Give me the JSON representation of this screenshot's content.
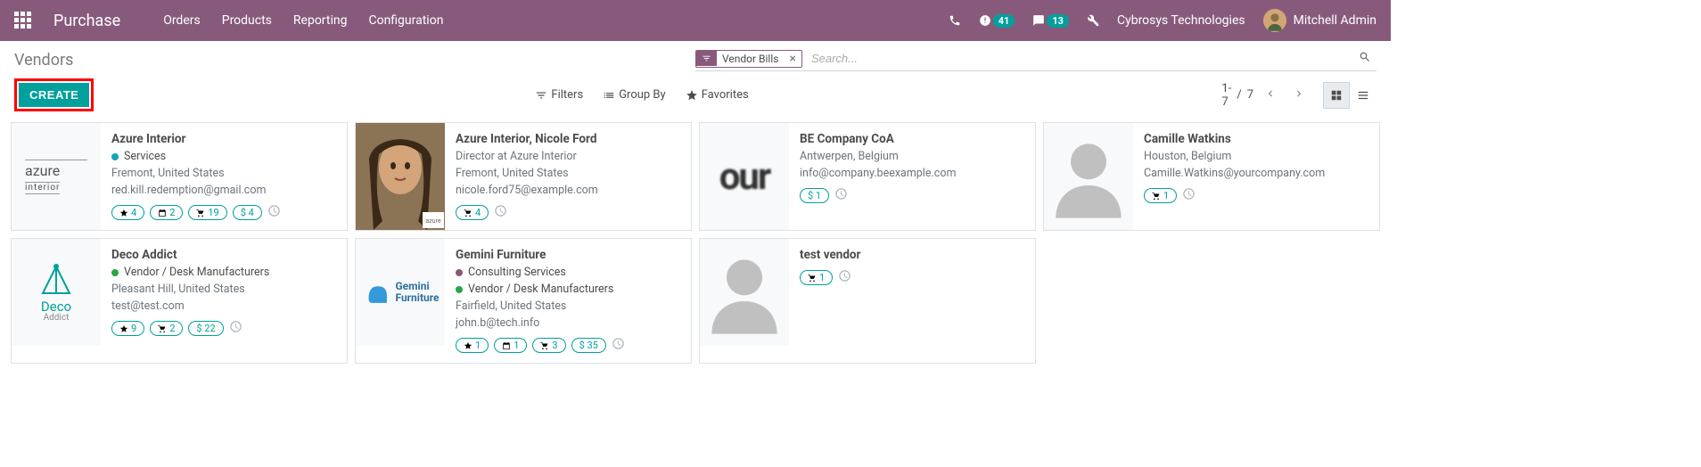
{
  "navbar": {
    "brand": "Purchase",
    "menu": [
      "Orders",
      "Products",
      "Reporting",
      "Configuration"
    ],
    "activity_badge": "41",
    "chat_badge": "13",
    "company": "Cybrosys Technologies",
    "user": "Mitchell Admin"
  },
  "breadcrumb": "Vendors",
  "search": {
    "facet_label": "Vendor Bills",
    "placeholder": "Search..."
  },
  "search_options": {
    "filters": "Filters",
    "group_by": "Group By",
    "favorites": "Favorites"
  },
  "create_label": "CREATE",
  "pager": {
    "range": "1-7",
    "separator": "/",
    "total": "7"
  },
  "cards": [
    {
      "title": "Azure Interior",
      "tags": [
        {
          "color": "blue",
          "label": "Services"
        }
      ],
      "line1": "Fremont, United States",
      "line2": "red.kill.redemption@gmail.com",
      "badges": [
        {
          "icon": "star",
          "value": "4"
        },
        {
          "icon": "calendar",
          "value": "2"
        },
        {
          "icon": "cart",
          "value": "19"
        },
        {
          "icon": "dollar",
          "value": "4"
        }
      ],
      "activity": true,
      "img": "azure-logo"
    },
    {
      "title": "Azure Interior, Nicole Ford",
      "subtitle": "Director at Azure Interior",
      "line1": "Fremont, United States",
      "line2": "nicole.ford75@example.com",
      "badges": [
        {
          "icon": "cart",
          "value": "4"
        }
      ],
      "activity": true,
      "img": "photo-woman"
    },
    {
      "title": "BE Company CoA",
      "line1": "Antwerpen, Belgium",
      "line2": "info@company.beexample.com",
      "badges": [
        {
          "icon": "dollar",
          "value": "1"
        }
      ],
      "activity": true,
      "img": "our-text"
    },
    {
      "title": "Camille Watkins",
      "line1": "Houston, Belgium",
      "line2": "Camille.Watkins@yourcompany.com",
      "badges": [
        {
          "icon": "cart",
          "value": "1"
        }
      ],
      "activity": true,
      "img": "silhouette"
    },
    {
      "title": "Deco Addict",
      "tags": [
        {
          "color": "green",
          "label": "Vendor / Desk Manufacturers"
        }
      ],
      "line1": "Pleasant Hill, United States",
      "line2": "test@test.com",
      "badges": [
        {
          "icon": "star",
          "value": "9"
        },
        {
          "icon": "cart",
          "value": "2"
        },
        {
          "icon": "dollar",
          "value": "22"
        }
      ],
      "activity": true,
      "img": "deco-logo"
    },
    {
      "title": "Gemini Furniture",
      "tags": [
        {
          "color": "purple",
          "label": "Consulting Services"
        },
        {
          "color": "green",
          "label": "Vendor / Desk Manufacturers"
        }
      ],
      "line1": "Fairfield, United States",
      "line2": "john.b@tech.info",
      "badges": [
        {
          "icon": "star",
          "value": "1"
        },
        {
          "icon": "calendar",
          "value": "1"
        },
        {
          "icon": "cart",
          "value": "3"
        },
        {
          "icon": "dollar",
          "value": "35"
        }
      ],
      "activity": true,
      "img": "gemini-logo"
    },
    {
      "title": "test vendor",
      "badges": [
        {
          "icon": "cart",
          "value": "1"
        }
      ],
      "activity": true,
      "img": "silhouette"
    }
  ]
}
